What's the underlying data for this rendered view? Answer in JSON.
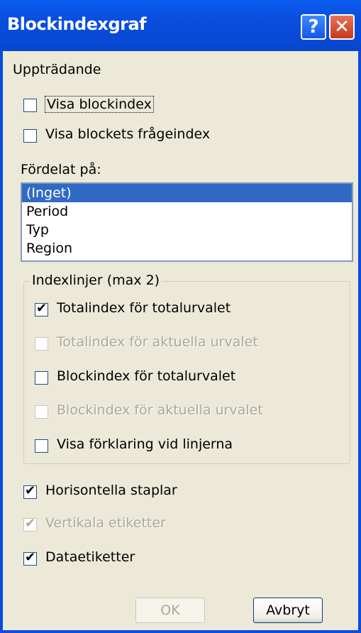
{
  "dialog": {
    "title": "Blockindexgraf",
    "help_glyph": "?",
    "close_glyph": "✕"
  },
  "appearance": {
    "label": "Uppträdande",
    "show_block_index": {
      "label": "Visa blockindex",
      "checked": false
    },
    "show_block_question_index": {
      "label": "Visa blockets frågeindex",
      "checked": false
    }
  },
  "distributed": {
    "label": "Fördelat på:",
    "options": [
      "(Inget)",
      "Period",
      "Typ",
      "Region"
    ],
    "selected": "(Inget)"
  },
  "index_lines": {
    "legend": "Indexlinjer (max 2)",
    "items": [
      {
        "label": "Totalindex för totalurvalet",
        "checked": true,
        "enabled": true
      },
      {
        "label": "Totalindex för aktuella urvalet",
        "checked": false,
        "enabled": false
      },
      {
        "label": "Blockindex för totalurvalet",
        "checked": false,
        "enabled": true
      },
      {
        "label": "Blockindex för aktuella urvalet",
        "checked": false,
        "enabled": false
      },
      {
        "label": "Visa förklaring vid linjerna",
        "checked": false,
        "enabled": true
      }
    ]
  },
  "options": {
    "horizontal_bars": {
      "label": "Horisontella staplar",
      "checked": true,
      "enabled": true
    },
    "vertical_labels": {
      "label": "Vertikala etiketter",
      "checked": true,
      "enabled": false
    },
    "data_labels": {
      "label": "Dataetiketter",
      "checked": true,
      "enabled": true
    }
  },
  "buttons": {
    "ok": "OK",
    "cancel": "Avbryt"
  },
  "icons": {
    "check": "✔"
  }
}
